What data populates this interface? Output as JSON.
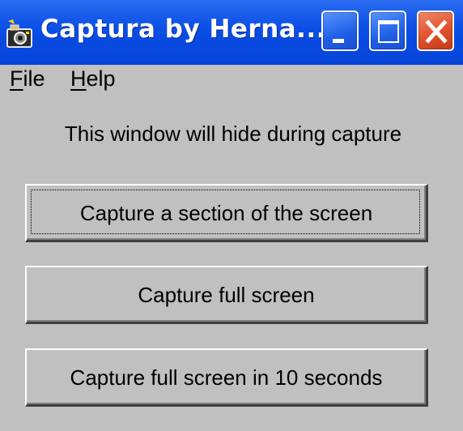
{
  "window": {
    "title": "Captura by Herna...",
    "icon": "camera-icon"
  },
  "titlebar_buttons": {
    "minimize": "minimize-icon",
    "maximize": "maximize-icon",
    "close": "close-icon"
  },
  "menu": {
    "file": {
      "mnemonic": "F",
      "rest": "ile"
    },
    "help": {
      "mnemonic": "H",
      "rest": "elp"
    }
  },
  "main": {
    "hint": "This window will hide during capture",
    "buttons": [
      {
        "label": "Capture a section of the screen",
        "focused": true
      },
      {
        "label": "Capture full screen",
        "focused": false
      },
      {
        "label": "Capture full screen in 10 seconds",
        "focused": false
      }
    ]
  },
  "colors": {
    "titlebar": "#0a4ee6",
    "close_button": "#e0512c",
    "window_bg": "#c0c0c0"
  }
}
